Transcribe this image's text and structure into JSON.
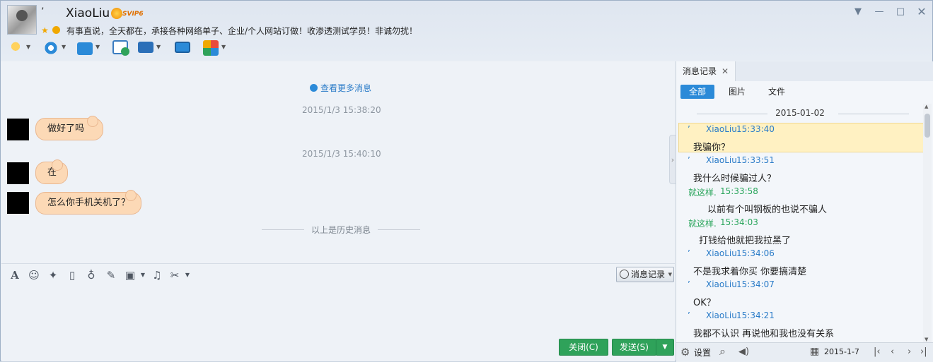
{
  "header": {
    "nick_prefix": "’",
    "nickname": "XiaoLiu",
    "vip_badge": "SVIP6",
    "signature": "有事直说，全天都在，承接各种网络单子、企业/个人网站订做！收渗透测试学员！非诚勿扰！"
  },
  "chat": {
    "more_messages": "查看更多消息",
    "history_divider": "以上是历史消息",
    "groups": [
      {
        "time": "2015/1/3 15:38:20",
        "messages": [
          "做好了吗"
        ]
      },
      {
        "time": "2015/1/3 15:40:10",
        "messages": [
          "在",
          "怎么你手机关机了？"
        ]
      }
    ]
  },
  "input_toolbar": {
    "history_button": "消息记录"
  },
  "buttons": {
    "close": "关闭(C)",
    "send": "发送(S)"
  },
  "history_panel": {
    "tab_title": "消息记录",
    "filters": [
      "全部",
      "图片",
      "文件"
    ],
    "date": "2015-01-02",
    "entries": [
      {
        "mark": "’",
        "sender": "XiaoLiu",
        "time": "15:33:40",
        "text": "我骗你？",
        "highlight": true,
        "side": "other"
      },
      {
        "mark": "’",
        "sender": "XiaoLiu",
        "time": "15:33:51",
        "text": "我什么时候骗过人？",
        "side": "other"
      },
      {
        "mark": "",
        "sender": "就这样.",
        "time": "15:33:58",
        "text": "以前有个叫钢板的也说不骗人",
        "side": "self"
      },
      {
        "mark": "",
        "sender": "就这样.",
        "time": "15:34:03",
        "text": "打钱给他就把我拉黑了",
        "side": "self"
      },
      {
        "mark": "’",
        "sender": "XiaoLiu",
        "time": "15:34:06",
        "text": "不是我求着你买 你要搞清楚",
        "side": "other"
      },
      {
        "mark": "’",
        "sender": "XiaoLiu",
        "time": "15:34:07",
        "text": "OK？",
        "side": "other"
      },
      {
        "mark": "’",
        "sender": "XiaoLiu",
        "time": "15:34:21",
        "text": "我都不认识 再说他和我也没有关系",
        "side": "other"
      }
    ],
    "footer": {
      "settings": "设置",
      "date": "2015-1-7"
    }
  },
  "colors": {
    "accent_blue": "#2b8ad8",
    "send_green": "#2fa25a",
    "bubble": "#fcd9b6",
    "highlight": "#fff1c2"
  }
}
